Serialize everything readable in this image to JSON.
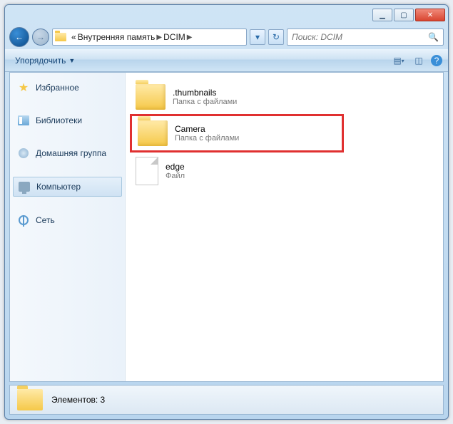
{
  "breadcrumb": {
    "prefix": "«",
    "parts": [
      "Внутренняя память",
      "DCIM"
    ]
  },
  "search": {
    "placeholder": "Поиск: DCIM"
  },
  "toolbar": {
    "organize": "Упорядочить"
  },
  "sidebar": {
    "favorites": "Избранное",
    "libraries": "Библиотеки",
    "homegroup": "Домашняя группа",
    "computer": "Компьютер",
    "network": "Сеть"
  },
  "items": [
    {
      "name": ".thumbnails",
      "desc": "Папка с файлами",
      "type": "folder",
      "highlighted": false
    },
    {
      "name": "Camera",
      "desc": "Папка с файлами",
      "type": "folder",
      "highlighted": true
    },
    {
      "name": "edge",
      "desc": "Файл",
      "type": "file",
      "highlighted": false
    }
  ],
  "status": {
    "text": "Элементов: 3"
  }
}
